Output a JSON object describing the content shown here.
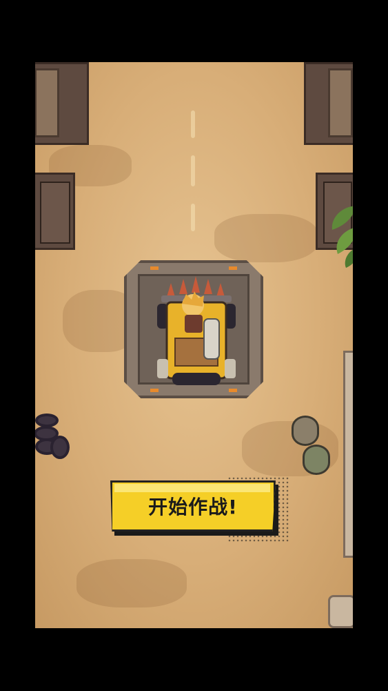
{
  "game": {
    "start_button_label": "开始作战!"
  },
  "icons": [
    "armored-vehicle-icon",
    "tire-stack-icon",
    "barrel-icon",
    "plant-icon",
    "building-icon"
  ],
  "colors": {
    "ground": "#d8ae78",
    "button": "#f5cf27",
    "pad": "#8a7a6c",
    "vehicle": "#e8b22a",
    "spike": "#c75a3a"
  }
}
